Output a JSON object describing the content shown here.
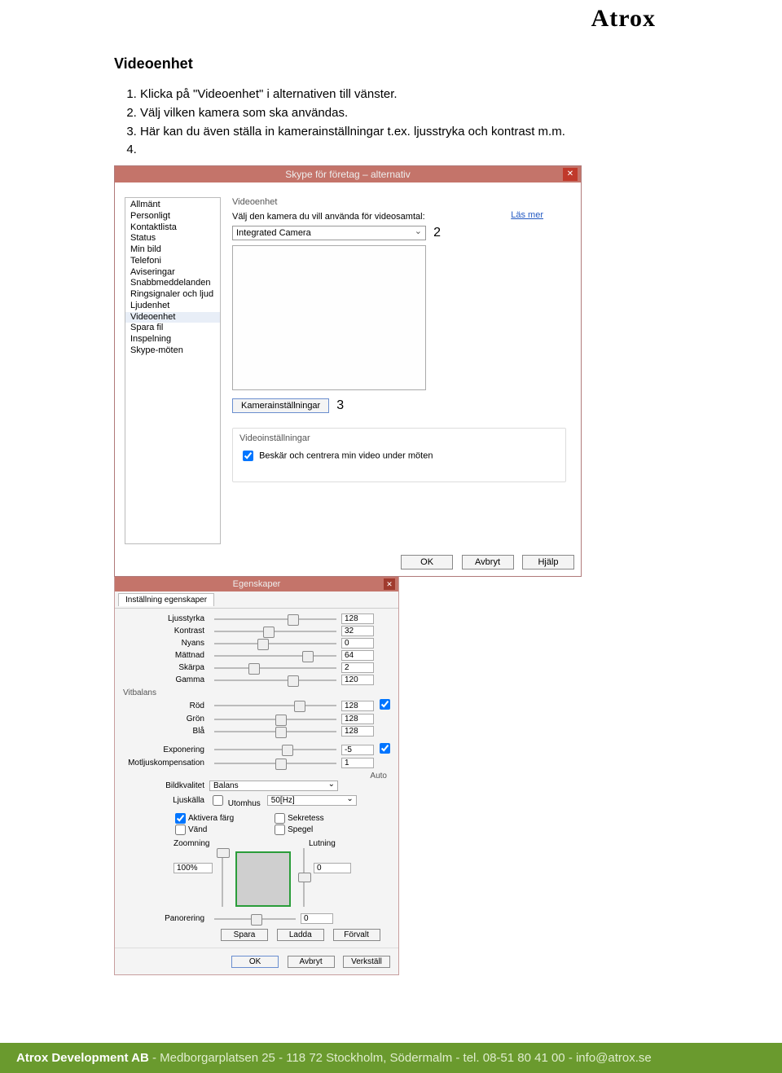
{
  "logo": "Atrox",
  "doc": {
    "title": "Videoenhet",
    "steps": [
      "Klicka på \"Videoenhet\" i alternativen till vänster.",
      "Välj vilken kamera som ska användas.",
      "Här kan du även ställa in kamerainställningar t.ex. ljusstryka och kontrast m.m.",
      ""
    ]
  },
  "win1": {
    "title": "Skype för företag – alternativ",
    "close": "✕",
    "sidebar": [
      "Allmänt",
      "Personligt",
      "Kontaktlista",
      "Status",
      "Min bild",
      "Telefoni",
      "Aviseringar",
      "Snabbmeddelanden",
      "Ringsignaler och ljud",
      "Ljudenhet",
      "Videoenhet",
      "Spara fil",
      "Inspelning",
      "Skype-möten"
    ],
    "sidebar_selected_index": 10,
    "heading": "Videoenhet",
    "camera_label": "Välj den kamera du vill använda för videosamtal:",
    "camera_value": "Integrated Camera",
    "annot2": "2",
    "learn_more": "Läs mer",
    "camera_settings_btn": "Kamerainställningar",
    "annot3": "3",
    "video_settings_heading": "Videoinställningar",
    "crop_checkbox_label": "Beskär och centrera min video under möten",
    "crop_checked": true,
    "btn_ok": "OK",
    "btn_cancel": "Avbryt",
    "btn_help": "Hjälp"
  },
  "win2": {
    "title": "Egenskaper",
    "close": "✕",
    "tab": "Inställning egenskaper",
    "rows": [
      {
        "label": "Ljusstyrka",
        "val": "128",
        "thumb": 60,
        "auto": null
      },
      {
        "label": "Kontrast",
        "val": "32",
        "thumb": 40,
        "auto": null
      },
      {
        "label": "Nyans",
        "val": "0",
        "thumb": 35,
        "auto": null
      },
      {
        "label": "Mättnad",
        "val": "64",
        "thumb": 72,
        "auto": null
      },
      {
        "label": "Skärpa",
        "val": "2",
        "thumb": 28,
        "auto": null
      },
      {
        "label": "Gamma",
        "val": "120",
        "thumb": 60,
        "auto": null
      }
    ],
    "vitbalans_label": "Vitbalans",
    "wb_rows": [
      {
        "label": "Röd",
        "val": "128",
        "thumb": 65,
        "auto": true
      },
      {
        "label": "Grön",
        "val": "128",
        "thumb": 50,
        "auto": null
      },
      {
        "label": "Blå",
        "val": "128",
        "thumb": 50,
        "auto": null
      }
    ],
    "exp_rows": [
      {
        "label": "Exponering",
        "val": "-5",
        "thumb": 55,
        "auto": true
      },
      {
        "label": "Motljuskompensation",
        "val": "1",
        "thumb": 50,
        "auto": null
      }
    ],
    "auto_header": "Auto",
    "bildkvalitet_label": "Bildkvalitet",
    "bildkvalitet_value": "Balans",
    "ljuskalla_label": "Ljuskälla",
    "utomhus_label": "Utomhus",
    "utomhus_checked": false,
    "ljuskalla_value": "50[Hz]",
    "cb_left": [
      {
        "label": "Aktivera färg",
        "checked": true
      },
      {
        "label": "Vänd",
        "checked": false
      }
    ],
    "cb_right": [
      {
        "label": "Sekretess",
        "checked": false
      },
      {
        "label": "Spegel",
        "checked": false
      }
    ],
    "zoom_label": "Zoomning",
    "zoom_value": "100%",
    "lutning_label": "Lutning",
    "lutning_value": "0",
    "pan_label": "Panorering",
    "pan_value": "0",
    "btn_save": "Spara",
    "btn_load": "Ladda",
    "btn_default": "Förvalt",
    "btn_ok": "OK",
    "btn_cancel": "Avbryt",
    "btn_apply": "Verkställ"
  },
  "footer": {
    "company": "Atrox Development AB",
    "rest": " - Medborgarplatsen 25 - 118 72 Stockholm, Södermalm - tel. 08-51 80 41 00 - info@atrox.se"
  }
}
